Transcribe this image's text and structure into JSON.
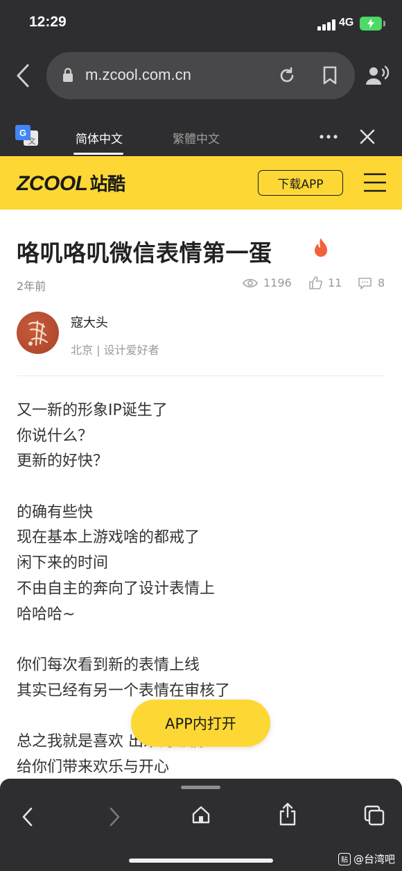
{
  "status_bar": {
    "time": "12:29",
    "network": "4G",
    "battery": "charging"
  },
  "browser": {
    "url": "m.zcool.com.cn",
    "icons": [
      "back-icon",
      "lock-icon",
      "reload-icon",
      "bookmark-icon",
      "reader-voice-icon"
    ]
  },
  "translate_bar": {
    "tab_simplified": "简体中文",
    "tab_traditional": "繁體中文",
    "active_tab": "简体中文",
    "icons": [
      "google-translate-icon",
      "more-icon",
      "close-icon"
    ]
  },
  "site_header": {
    "logo_latin": "ZCOOL",
    "logo_cn": "站酷",
    "download_button": "下载APP",
    "icons": [
      "menu-icon"
    ],
    "colors": {
      "accent": "#fdd835"
    }
  },
  "article": {
    "title": "咯叽咯叽微信表情第一蛋",
    "time": "2年前",
    "views": "1196",
    "likes": "11",
    "comments": "8",
    "author_name": "寇大头",
    "author_meta": "北京 | 设计爱好者",
    "body_lines": [
      "又一新的形象IP诞生了",
      "你说什么？",
      "更新的好快？",
      "",
      "的确有些快",
      "现在基本上游戏啥的都戒了",
      "闲下来的时间",
      "不由自主的奔向了设计表情上",
      "哈哈哈~",
      "",
      "你们每次看到新的表情上线",
      "其实已经有另一个表情在审核了",
      "",
      "总之我就是喜欢                    出来的它们",
      "给你们带来欢乐与开心"
    ]
  },
  "open_app_button": "APP内打开",
  "bottom_toolbar": {
    "icons": [
      "back-icon",
      "forward-icon",
      "home-icon",
      "share-icon",
      "tabs-icon"
    ]
  },
  "watermark": {
    "badge": "贴",
    "text": "@台湾吧"
  }
}
